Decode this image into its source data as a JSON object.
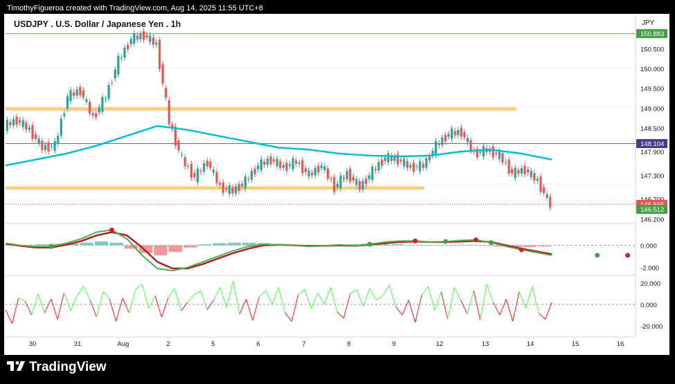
{
  "header": {
    "attribution": "TimothyFigueroa created with TradingView.com, Aug 14, 2025 11:55 UTC+8",
    "symbol_title": "USDJPY . U.S. Dollar / Japanese Yen . 1h",
    "currency": "JPY"
  },
  "footer": {
    "brand": "TradingView",
    "brand_icon": "tradingview-logo-icon"
  },
  "colors": {
    "up": "#26a69a",
    "down": "#ef5350",
    "ma": "#00bcd4",
    "zone": "#ffcc80",
    "resistance": "#4caf50",
    "price_line": "#ef5350",
    "mid_line": "#7e57c2",
    "macd_fast": "#4caf50",
    "macd_slow": "#b71c1c",
    "osc_up": "#66ff66",
    "osc_down": "#ff4444"
  },
  "chart_data": [
    {
      "type": "candlestick",
      "title": "USDJPY . U.S. Dollar / Japanese Yen . 1h",
      "x_tick_labels": [
        "30",
        "31",
        "Aug",
        "2",
        "5",
        "6",
        "7",
        "8",
        "9",
        "12",
        "13",
        "14",
        "15",
        "16"
      ],
      "y_tick_labels": [
        "150.500",
        "150.000",
        "149.500",
        "149.000",
        "148.500",
        "147.900",
        "147.300",
        "146.700",
        "146.200"
      ],
      "ylim": [
        146.1,
        151.0
      ],
      "price_series": [
        {
          "day": "30",
          "close": 148.55
        },
        {
          "day": "30",
          "close": 148.7
        },
        {
          "day": "30",
          "close": 148.45
        },
        {
          "day": "30",
          "close": 148.0
        },
        {
          "day": "31",
          "close": 148.05
        },
        {
          "day": "31",
          "close": 149.3
        },
        {
          "day": "31",
          "close": 149.45
        },
        {
          "day": "31",
          "close": 148.75
        },
        {
          "day": "31",
          "close": 149.3
        },
        {
          "day": "Aug",
          "close": 150.2
        },
        {
          "day": "Aug",
          "close": 150.75
        },
        {
          "day": "Aug",
          "close": 150.85
        },
        {
          "day": "Aug",
          "close": 150.6
        },
        {
          "day": "2",
          "close": 148.65
        },
        {
          "day": "2",
          "close": 147.7
        },
        {
          "day": "2",
          "close": 147.25
        },
        {
          "day": "5",
          "close": 147.65
        },
        {
          "day": "5",
          "close": 147.0
        },
        {
          "day": "5",
          "close": 146.9
        },
        {
          "day": "5",
          "close": 147.15
        },
        {
          "day": "6",
          "close": 147.55
        },
        {
          "day": "6",
          "close": 147.7
        },
        {
          "day": "6",
          "close": 147.5
        },
        {
          "day": "7",
          "close": 147.65
        },
        {
          "day": "7",
          "close": 147.3
        },
        {
          "day": "7",
          "close": 147.55
        },
        {
          "day": "8",
          "close": 147.0
        },
        {
          "day": "8",
          "close": 147.35
        },
        {
          "day": "8",
          "close": 147.0
        },
        {
          "day": "9",
          "close": 147.4
        },
        {
          "day": "9",
          "close": 147.75
        },
        {
          "day": "9",
          "close": 147.7
        },
        {
          "day": "12",
          "close": 147.5
        },
        {
          "day": "12",
          "close": 147.55
        },
        {
          "day": "12",
          "close": 148.05
        },
        {
          "day": "12",
          "close": 148.35
        },
        {
          "day": "13",
          "close": 148.4
        },
        {
          "day": "13",
          "close": 147.85
        },
        {
          "day": "13",
          "close": 147.95
        },
        {
          "day": "13",
          "close": 147.8
        },
        {
          "day": "14",
          "close": 147.35
        },
        {
          "day": "14",
          "close": 147.45
        },
        {
          "day": "14",
          "close": 147.15
        },
        {
          "day": "14",
          "close": 146.55
        }
      ],
      "moving_average": [
        147.55,
        147.7,
        147.85,
        148.05,
        148.3,
        148.55,
        148.45,
        148.3,
        148.15,
        148.0,
        147.95,
        147.85,
        147.8,
        147.78,
        147.8,
        147.9,
        147.95,
        147.85,
        147.7
      ],
      "horizontal_levels": {
        "resistance": 150.883,
        "upper_zone": 148.98,
        "mid_line": 148.104,
        "lower_zone": 146.98,
        "price_line": 146.565
      },
      "price_labels": {
        "resistance": "150.883",
        "mid": "148.104",
        "last": "146.565",
        "bid": "146.512"
      }
    },
    {
      "type": "line",
      "title": "",
      "y_tick_labels": [
        "0.000",
        "-2.000"
      ],
      "fast_line": [
        0.2,
        0.0,
        -0.1,
        -0.1,
        0.2,
        0.6,
        1.2,
        1.4,
        0.6,
        -0.9,
        -2.1,
        -2.3,
        -2.0,
        -1.5,
        -1.0,
        -0.5,
        -0.1,
        0.1,
        0.05,
        0.0,
        -0.1,
        -0.05,
        0.05,
        -0.05,
        0.1,
        0.3,
        0.4,
        0.4,
        0.3,
        0.35,
        0.45,
        0.5,
        0.25,
        -0.1,
        -0.4,
        -0.65,
        -0.9
      ],
      "slow_line": [
        0.15,
        -0.05,
        -0.2,
        -0.2,
        0.05,
        0.4,
        0.9,
        1.2,
        0.9,
        -0.2,
        -1.5,
        -2.1,
        -2.1,
        -1.7,
        -1.2,
        -0.7,
        -0.3,
        0.0,
        0.05,
        0.0,
        -0.05,
        -0.05,
        0.0,
        -0.05,
        0.05,
        0.2,
        0.3,
        0.35,
        0.3,
        0.3,
        0.35,
        0.4,
        0.3,
        0.0,
        -0.3,
        -0.55,
        -0.8
      ],
      "histogram": [
        0.05,
        0.0,
        0.1,
        0.15,
        0.2,
        0.25,
        0.35,
        0.25,
        -0.3,
        -0.7,
        -0.9,
        -0.6,
        -0.2,
        0.1,
        0.2,
        0.25,
        0.25,
        0.2,
        0.1,
        0.05,
        0.0,
        -0.05,
        0.05,
        0.1,
        0.15,
        0.15,
        0.1,
        0.05,
        0.05,
        0.05,
        0.05,
        0.05,
        -0.05,
        -0.1,
        -0.15,
        -0.15,
        -0.1
      ]
    },
    {
      "type": "line",
      "title": "",
      "y_tick_labels": [
        "20.000",
        "0.000",
        "-20.000"
      ],
      "values": [
        -5,
        -18,
        6,
        3,
        -10,
        10,
        -8,
        5,
        -14,
        11,
        -6,
        8,
        17,
        4,
        -12,
        12,
        5,
        -16,
        6,
        -8,
        14,
        19,
        -4,
        8,
        -12,
        6,
        15,
        -6,
        2,
        9,
        13,
        -5,
        4,
        16,
        -3,
        22,
        -9,
        5,
        -15,
        7,
        13,
        0,
        16,
        -8,
        -16,
        9,
        14,
        -4,
        11,
        0,
        16,
        -7,
        -13,
        10,
        14,
        -2,
        15,
        4,
        8,
        18,
        -2,
        -10,
        4,
        -17,
        9,
        17,
        -6,
        12,
        -14,
        16,
        4,
        -9,
        13,
        -15,
        19,
        2,
        -10,
        5,
        -16,
        12,
        -4,
        17,
        -8,
        -14,
        2
      ]
    }
  ]
}
